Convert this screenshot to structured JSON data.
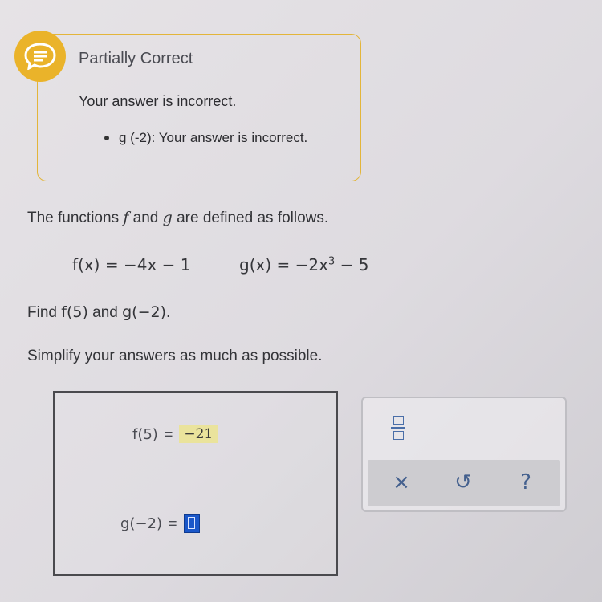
{
  "feedback": {
    "title": "Partially Correct",
    "message": "Your answer is incorrect.",
    "detail": "g (-2): Your answer is incorrect.",
    "badge_icon": "chat-bubble-icon",
    "accent_color": "#eab32a"
  },
  "problem": {
    "intro_prefix": "The functions ",
    "f_name": "f",
    "intro_mid": " and ",
    "g_name": "g",
    "intro_suffix": " are defined as follows.",
    "f_def": "f(x) = −4x − 1",
    "g_def_main": "g(x) = −2x",
    "g_def_exp": "3",
    "g_def_tail": " − 5",
    "find_prefix": "Find ",
    "find_f": "f(5)",
    "find_mid": " and ",
    "find_g": "g(−2)",
    "find_suffix": ".",
    "instruction": "Simplify your answers as much as possible."
  },
  "answers": {
    "f_label": "f(5)",
    "f_equals": "=",
    "f_value": "−21",
    "g_label": "g(−2)",
    "g_equals": "="
  },
  "toolbar": {
    "fraction_icon": "fraction-icon",
    "clear": "×",
    "undo": "↺",
    "help": "?"
  }
}
